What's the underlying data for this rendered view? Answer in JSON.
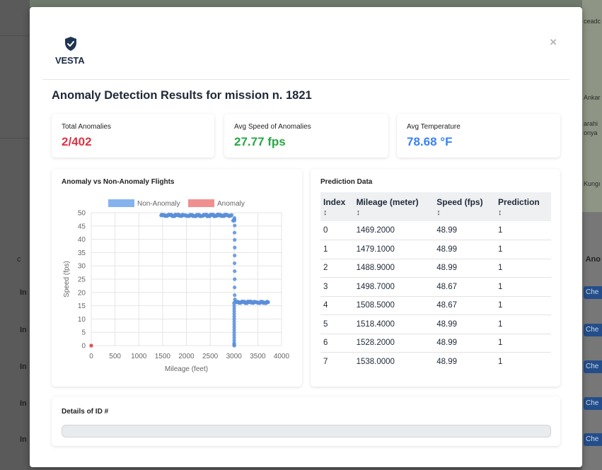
{
  "background": {
    "left_rows": [
      "In",
      "In",
      "In",
      "In",
      "In"
    ],
    "left_column_header": "c",
    "right_column_header": "Ano",
    "right_buttons": [
      "Che",
      "Che",
      "Che",
      "Che",
      "Che"
    ],
    "map_labels": [
      "ceadc",
      "Ankar",
      "arahi",
      "onya",
      "Kungı"
    ]
  },
  "modal": {
    "logo_text": "VESTA",
    "close_icon": "×",
    "title": "Anomaly Detection Results for mission n. 1821",
    "stats": [
      {
        "label": "Total Anomalies",
        "value": "2/402",
        "color": "#dc3545"
      },
      {
        "label": "Avg Speed of Anomalies",
        "value": "27.77 fps",
        "color": "#28a745"
      },
      {
        "label": "Avg Temperature",
        "value": "78.68 °F",
        "color": "#3b82f6"
      }
    ],
    "chart_title": "Anomaly vs Non-Anomaly Flights",
    "table_title": "Prediction Data",
    "table": {
      "headers": [
        "Index",
        "Mileage (meter)",
        "Speed (fps)",
        "Prediction"
      ],
      "sort_glyph": "↕",
      "rows": [
        [
          "0",
          "1469.2000",
          "48.99",
          "1"
        ],
        [
          "1",
          "1479.1000",
          "48.99",
          "1"
        ],
        [
          "2",
          "1488.9000",
          "48.99",
          "1"
        ],
        [
          "3",
          "1498.7000",
          "48.67",
          "1"
        ],
        [
          "4",
          "1508.5000",
          "48.67",
          "1"
        ],
        [
          "5",
          "1518.4000",
          "48.99",
          "1"
        ],
        [
          "6",
          "1528.2000",
          "48.99",
          "1"
        ],
        [
          "7",
          "1538.0000",
          "48.99",
          "1"
        ]
      ]
    },
    "details_title": "Details of ID #"
  },
  "chart_data": {
    "type": "scatter",
    "title": "",
    "xlabel": "Mileage (feet)",
    "ylabel": "Speed (fps)",
    "xlim": [
      0,
      4000
    ],
    "ylim": [
      0,
      50
    ],
    "xticks": [
      0,
      500,
      1000,
      1500,
      2000,
      2500,
      3000,
      3500,
      4000
    ],
    "yticks": [
      0,
      5,
      10,
      15,
      20,
      25,
      30,
      35,
      40,
      45,
      50
    ],
    "grid": true,
    "legend": "top",
    "series": [
      {
        "name": "Non-Anomaly",
        "color": "#5b8fd9",
        "legend_color": "#86b3f0",
        "segments": [
          {
            "x_from": 1469,
            "x_to": 2950,
            "y": 49,
            "count": 150
          },
          {
            "x_from": 2980,
            "x_to": 3010,
            "y": 47,
            "count": 3
          }
        ],
        "points": [
          [
            3010,
            48
          ],
          [
            3010,
            47.5
          ],
          [
            3015,
            45.2
          ],
          [
            3012,
            42.5
          ],
          [
            3015,
            39.8
          ],
          [
            3016,
            36.9
          ],
          [
            3014,
            33.9
          ],
          [
            3012,
            31.0
          ],
          [
            3015,
            28.0
          ],
          [
            3016,
            25.0
          ],
          [
            3013,
            21.9
          ],
          [
            3015,
            19.0
          ],
          [
            3020,
            17.4
          ],
          [
            3025,
            16.6
          ],
          [
            3000,
            16.0
          ],
          [
            3005,
            15.0
          ],
          [
            3005,
            14.0
          ],
          [
            3005,
            13.0
          ],
          [
            3005,
            12.0
          ],
          [
            3005,
            11.0
          ],
          [
            3005,
            10.0
          ],
          [
            3005,
            9.0
          ],
          [
            3005,
            8.0
          ],
          [
            3005,
            7.0
          ],
          [
            3005,
            6.0
          ],
          [
            3005,
            5.0
          ],
          [
            3005,
            4.0
          ],
          [
            3005,
            3.0
          ],
          [
            3005,
            2.0
          ],
          [
            3005,
            1.0
          ],
          [
            3005,
            0.5
          ],
          [
            3005,
            0.2
          ],
          [
            3005,
            0.0
          ]
        ],
        "segments2": [
          {
            "x_from": 3030,
            "x_to": 3720,
            "y": 16.3,
            "count": 80
          }
        ]
      },
      {
        "name": "Anomaly",
        "color": "#e05050",
        "legend_color": "#f08f8f",
        "points": [
          [
            0,
            0
          ],
          [
            0,
            0
          ]
        ]
      }
    ]
  }
}
